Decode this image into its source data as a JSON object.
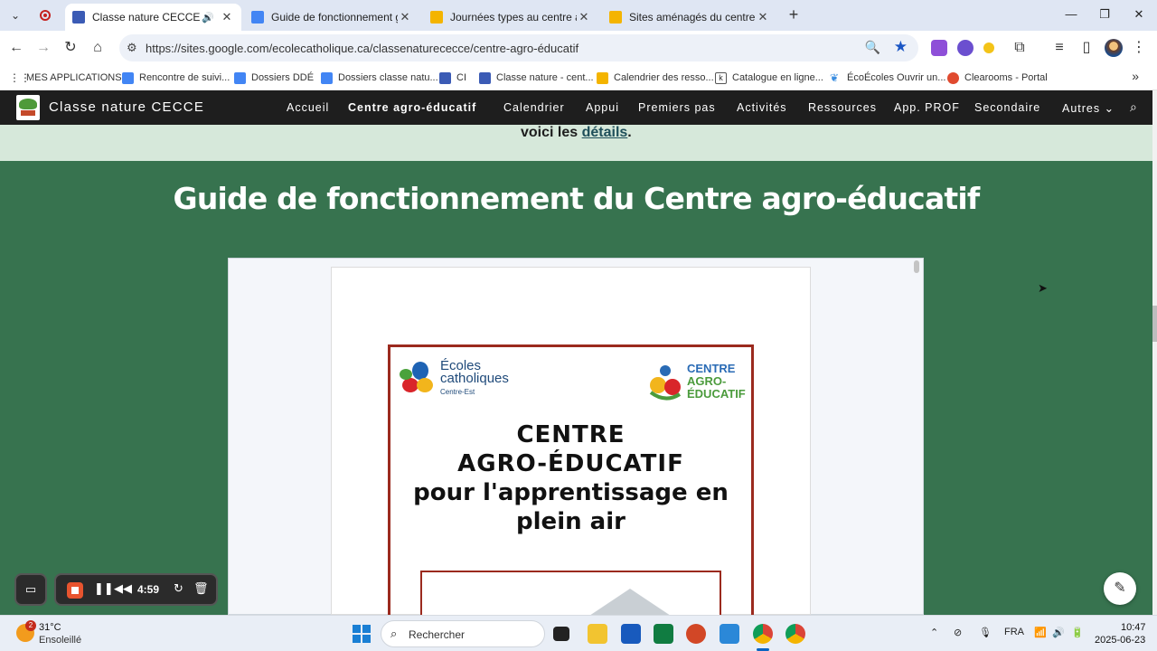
{
  "browser": {
    "tabs": [
      {
        "title": "Classe nature CECCE - Cent",
        "active": true,
        "favicon_color": "#3b5bb5",
        "audio": true
      },
      {
        "title": "Guide de fonctionnement géné",
        "active": false,
        "favicon_color": "#4285f4"
      },
      {
        "title": "Journées types au centre agro-é",
        "active": false,
        "favicon_color": "#f4b400"
      },
      {
        "title": "Sites aménagés du centre agro",
        "active": false,
        "favicon_color": "#f4b400"
      }
    ],
    "url": "https://sites.google.com/ecolecatholique.ca/classenaturececce/centre-agro-éducatif",
    "bookmarks": [
      "MES APPLICATIONS",
      "Rencontre de suivi...",
      "Dossiers DDÉ",
      "Dossiers classe natu...",
      "CI",
      "Classe nature - cent...",
      "Calendrier des resso...",
      "Catalogue en ligne...",
      "ÉcoÉcoles Ouvrir un...",
      "Clearooms - Portal"
    ]
  },
  "site": {
    "name": "Classe nature CECCE",
    "nav": [
      "Accueil",
      "Centre agro-éducatif",
      "Calendrier",
      "Appui",
      "Premiers pas",
      "Activités",
      "Ressources",
      "App. PROF",
      "Secondaire",
      "Autres"
    ],
    "intro_text": "voici les",
    "intro_link": "détails",
    "intro_end": ".",
    "section_title": "Guide de fonctionnement du Centre agro-éducatif"
  },
  "document": {
    "logo_left_line1": "Écoles",
    "logo_left_line2": "catholiques",
    "logo_left_sub": "Centre-Est",
    "logo_right_line1": "CENTRE",
    "logo_right_line2": "AGRO-",
    "logo_right_line3": "ÉDUCATIF",
    "title_line1": "CENTRE",
    "title_line2": "AGRO-ÉDUCATIF",
    "title_line3": "pour l'apprentissage en",
    "title_line4": "plein air"
  },
  "recorder": {
    "time": "4:59"
  },
  "taskbar": {
    "weather_badge": "2",
    "temperature": "31°C",
    "weather_desc": "Ensoleillé",
    "search_placeholder": "Rechercher",
    "language": "FRA",
    "time": "10:47",
    "date": "2025-06-23"
  },
  "colors": {
    "site_header": "#1e1e1e",
    "band_light": "#d6e8da",
    "band_green": "#37734f",
    "poster_border": "#9b2a1e"
  }
}
